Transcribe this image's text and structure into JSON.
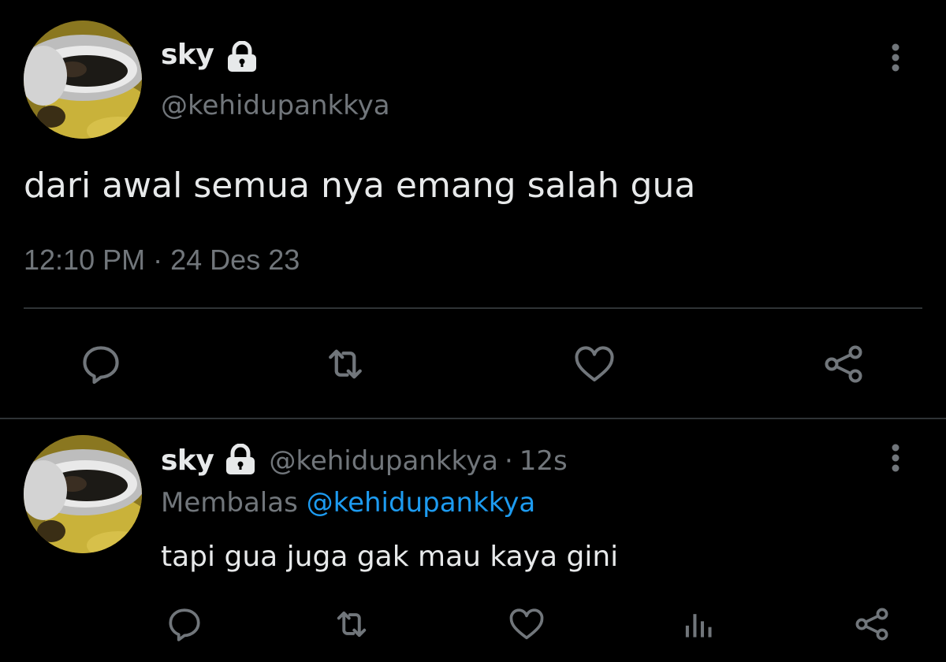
{
  "main_tweet": {
    "display_name": "sky",
    "handle": "@kehidupankkya",
    "text": "dari awal semua nya emang salah gua",
    "time": "12:10 PM",
    "separator": "·",
    "date": "24 Des 23"
  },
  "reply": {
    "display_name": "sky",
    "handle": "@kehidupankkya",
    "separator": "·",
    "age": "12s",
    "replying_prefix": "Membalas",
    "replying_to": "@kehidupankkya",
    "text": "tapi gua juga gak mau kaya gini"
  },
  "icons": {
    "lock": "lock-icon",
    "more": "more-vertical-icon",
    "reply": "reply-icon",
    "retweet": "retweet-icon",
    "like": "heart-icon",
    "share": "share-icon",
    "analytics": "analytics-icon"
  },
  "colors": {
    "background": "#000000",
    "text": "#e7e9ea",
    "secondary": "#71767b",
    "link": "#1d9bf0",
    "divider": "#2f3336"
  }
}
